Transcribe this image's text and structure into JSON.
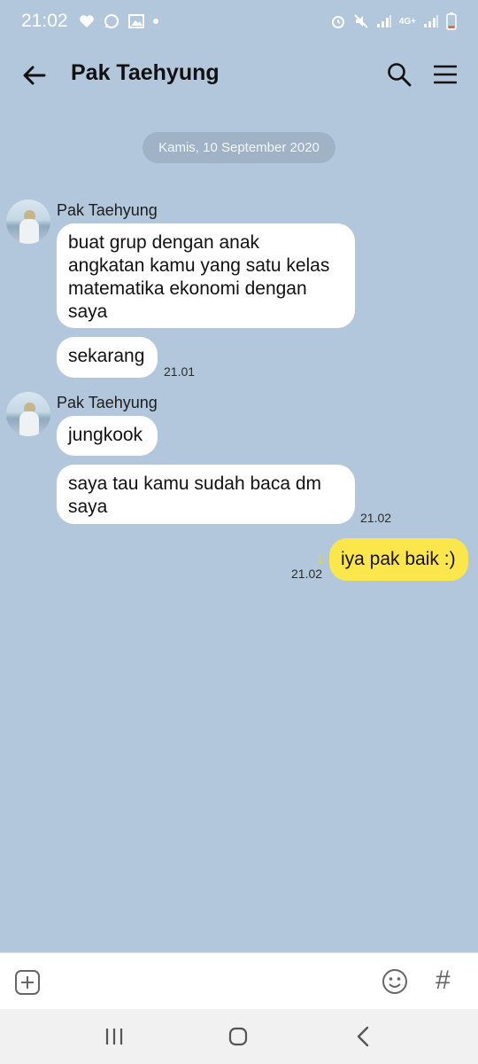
{
  "status_bar": {
    "time": "21:02",
    "left_icons": [
      "heart-icon",
      "whatsapp-icon",
      "gallery-icon",
      "dot-icon"
    ],
    "right_icons": [
      "alarm-icon",
      "mute-icon",
      "signal-icon",
      "4g-icon",
      "signal-icon",
      "battery-icon"
    ],
    "network_label": "4G+"
  },
  "header": {
    "title": "Pak Taehyung",
    "back_icon": "arrow-left-icon",
    "search_icon": "search-icon",
    "menu_icon": "hamburger-menu-icon"
  },
  "chat": {
    "date": "Kamis, 10 September 2020",
    "groups": [
      {
        "sender": "Pak Taehyung",
        "messages": [
          {
            "lines": [
              "buat grup dengan anak",
              "angkatan kamu yang satu kelas",
              "matematika ekonomi dengan",
              "saya"
            ]
          },
          {
            "lines": [
              "sekarang"
            ],
            "time": "21.01"
          }
        ]
      },
      {
        "sender": "Pak Taehyung",
        "messages": [
          {
            "lines": [
              "jungkook"
            ]
          },
          {
            "lines": [
              "saya tau kamu sudah baca dm",
              "saya"
            ],
            "time": "21.02"
          }
        ]
      }
    ],
    "outgoing": {
      "text": "iya pak baik :)",
      "read_count": "1",
      "time": "21.02"
    }
  },
  "input_bar": {
    "plus_icon": "plus-box-icon",
    "emoji_icon": "emoji-icon",
    "hash_label": "#"
  },
  "nav_bar": {
    "recents_icon": "recents-icon",
    "home_icon": "home-icon",
    "back_icon": "back-chevron-icon"
  },
  "colors": {
    "background": "#b3c7dc",
    "outgoing_bubble": "#fbe74b",
    "incoming_bubble": "#ffffff",
    "date_pill": "#9fb2c6"
  }
}
